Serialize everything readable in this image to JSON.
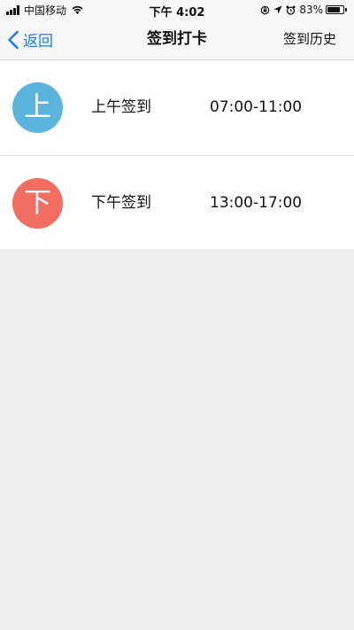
{
  "status_bar": {
    "carrier": "中国移动",
    "time": "下午 4:02",
    "battery_percent": "83%",
    "battery_level": 0.83,
    "icons": [
      "signal-icon",
      "wifi-icon",
      "orientation-lock-icon",
      "location-arrow-icon",
      "alarm-clock-icon",
      "battery-icon"
    ]
  },
  "nav": {
    "back_label": "返回",
    "title": "签到打卡",
    "right_label": "签到历史"
  },
  "checkins": [
    {
      "badge": "上",
      "label": "上午签到",
      "time": "07:00-11:00",
      "color": "#5ab4dd"
    },
    {
      "badge": "下",
      "label": "下午签到",
      "time": "13:00-17:00",
      "color": "#f26d62"
    }
  ],
  "colors": {
    "accent": "#1a7cf5",
    "background": "#efefef"
  }
}
